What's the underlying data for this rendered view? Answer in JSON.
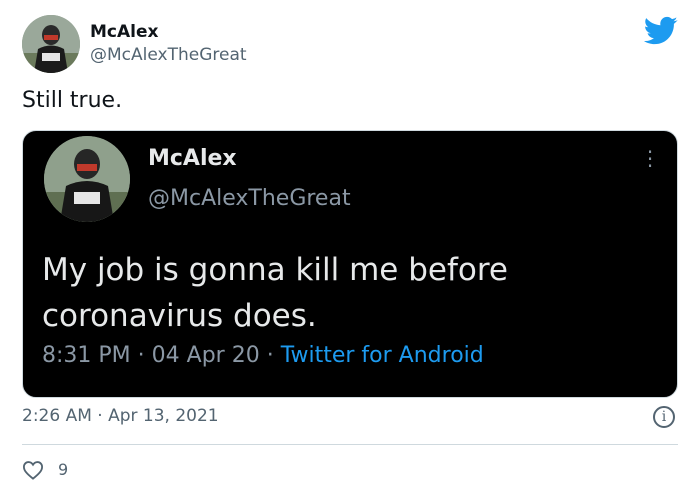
{
  "author": {
    "name": "McAlex",
    "handle": "@McAlexTheGreat"
  },
  "tweet": {
    "text": "Still true."
  },
  "embedded": {
    "name": "McAlex",
    "handle": "@McAlexTheGreat",
    "text": "My job is gonna kill me before coronavirus does.",
    "time": "8:31 PM",
    "date": "04 Apr 20",
    "separator": "·",
    "source": "Twitter for Android"
  },
  "meta": {
    "timestamp": "2:26 AM · Apr 13, 2021",
    "likes": "9"
  },
  "icons": [
    "twitter-bird-icon",
    "more-options-icon",
    "info-icon",
    "heart-icon"
  ],
  "colors": {
    "brand": "#1d9bf0",
    "embed_bg": "#000000",
    "muted": "#536471"
  }
}
